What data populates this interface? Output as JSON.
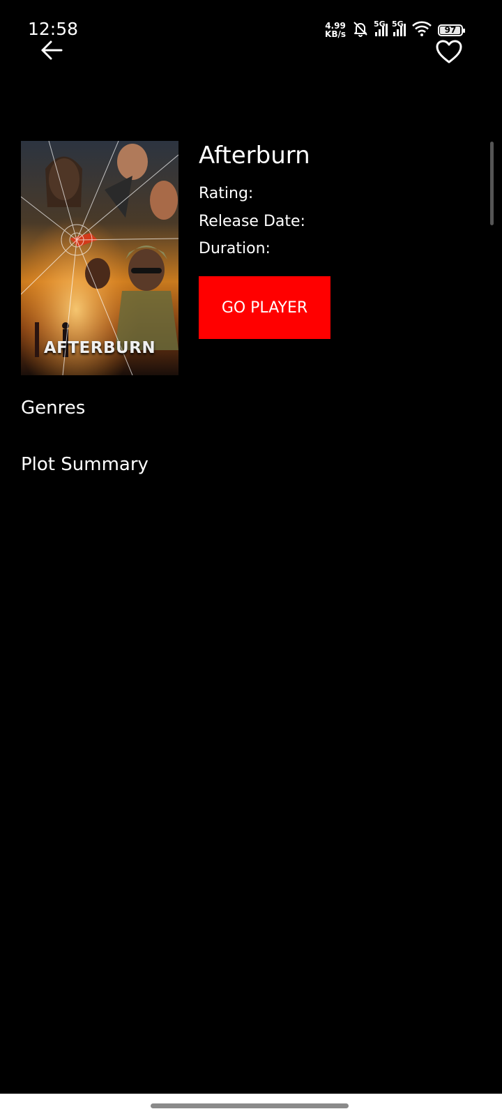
{
  "status_bar": {
    "time": "12:58",
    "net_speed_value": "4.99",
    "net_speed_unit": "KB/s",
    "sim1_label": "5G",
    "sim2_label": "5G",
    "battery_level": "97"
  },
  "movie": {
    "title": "Afterburn",
    "poster_title": "AFTERBURN",
    "rating_label": "Rating:",
    "release_label": "Release Date:",
    "duration_label": "Duration:"
  },
  "actions": {
    "play_label": "GO PLAYER"
  },
  "sections": {
    "genres": "Genres",
    "plot_summary": "Plot Summary"
  },
  "icons": {
    "back": "arrow-left-icon",
    "favorite": "heart-outline-icon"
  },
  "colors": {
    "background": "#000000",
    "accent": "#ff0000",
    "text": "#ffffff"
  }
}
